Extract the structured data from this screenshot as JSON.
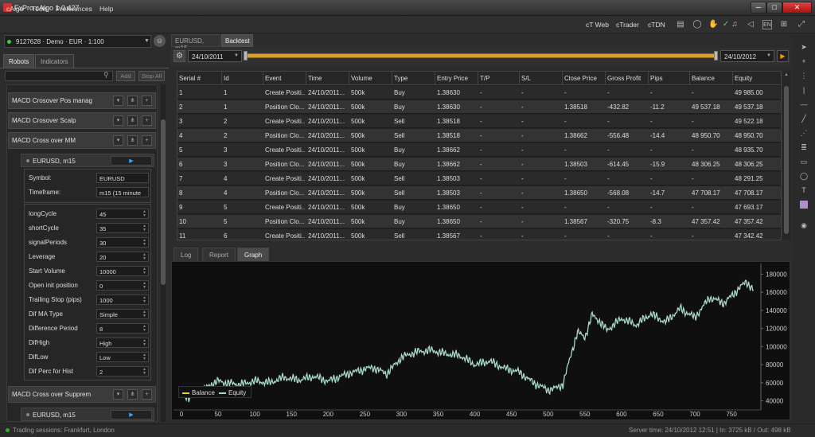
{
  "window": {
    "title": "FxPro cAlgo 1.0.427",
    "min": "─",
    "max": "□",
    "close": "✕"
  },
  "menu": [
    "cAlgo",
    "Tools",
    "Preferences",
    "Help"
  ],
  "toplinks": [
    "cT Web",
    "cTrader",
    "cTDN"
  ],
  "toolbar_icons": [
    "document-icon",
    "chat-icon",
    "hand-icon",
    "check-icon",
    "speaker-icon",
    "keyboard-icon",
    "zoom-icon"
  ],
  "account": {
    "label": "9127628 · Demo · EUR · 1:100"
  },
  "left_tabs": [
    "Robots",
    "Indicators"
  ],
  "left_search": {
    "add": "Add",
    "stop_all": "Stop All"
  },
  "robots": [
    {
      "name": "MACD Crosover Pos  manag"
    },
    {
      "name": "MACD Crosover Scalp"
    },
    {
      "name": "MACD Cross over MM"
    }
  ],
  "instance": {
    "name": "EURUSD, m15"
  },
  "settings": [
    {
      "label": "Symbol:",
      "value": "EURUSD"
    },
    {
      "label": "Timeframe:",
      "value": "m15 (15 minute"
    }
  ],
  "params": [
    {
      "label": "longCycle",
      "value": "45"
    },
    {
      "label": "shortCycle",
      "value": "35"
    },
    {
      "label": "signalPeriods",
      "value": "30"
    },
    {
      "label": "Leverage",
      "value": "20"
    },
    {
      "label": "Start Volume",
      "value": "10000"
    },
    {
      "label": "Open init position",
      "value": "0"
    },
    {
      "label": "Trailing Stop (pips)",
      "value": "1000"
    },
    {
      "label": "Dif MA Type",
      "value": "Simple"
    },
    {
      "label": "Difference Period",
      "value": "8"
    },
    {
      "label": "DifHigh",
      "value": "High"
    },
    {
      "label": "DifLow",
      "value": "Low"
    },
    {
      "label": "Dif Perc for Hist",
      "value": "2"
    }
  ],
  "robot2": {
    "name": "MACD Cross over Supprem"
  },
  "instance2": {
    "name": "EURUSD, m15"
  },
  "doc_tabs": {
    "chart": "EURUSD, m15",
    "backtest": "Backtest"
  },
  "dates": {
    "start": "24/10/2011",
    "end": "24/10/2012"
  },
  "table": {
    "columns": [
      "Serial #",
      "Id",
      "Event",
      "Time",
      "Volume",
      "Type",
      "Entry Price",
      "T/P",
      "S/L",
      "Close Price",
      "Gross Profit",
      "Pips",
      "Balance",
      "Equity"
    ],
    "rows": [
      [
        "1",
        "1",
        "Create Positi...",
        "24/10/2011...",
        "500k",
        "Buy",
        "1.38630",
        "-",
        "-",
        "-",
        "-",
        "-",
        "-",
        "49 985.00"
      ],
      [
        "2",
        "1",
        "Position Clo...",
        "24/10/2011...",
        "500k",
        "Buy",
        "1.38630",
        "-",
        "-",
        "1.38518",
        "-432.82",
        "-11.2",
        "49 537.18",
        "49 537.18"
      ],
      [
        "3",
        "2",
        "Create Positi...",
        "24/10/2011...",
        "500k",
        "Sell",
        "1.38518",
        "-",
        "-",
        "-",
        "-",
        "-",
        "-",
        "49 522.18"
      ],
      [
        "4",
        "2",
        "Position Clo...",
        "24/10/2011...",
        "500k",
        "Sell",
        "1.38518",
        "-",
        "-",
        "1.38662",
        "-556.48",
        "-14.4",
        "48 950.70",
        "48 950.70"
      ],
      [
        "5",
        "3",
        "Create Positi...",
        "24/10/2011...",
        "500k",
        "Buy",
        "1.38662",
        "-",
        "-",
        "-",
        "-",
        "-",
        "-",
        "48 935.70"
      ],
      [
        "6",
        "3",
        "Position Clo...",
        "24/10/2011...",
        "500k",
        "Buy",
        "1.38662",
        "-",
        "-",
        "1.38503",
        "-614.45",
        "-15.9",
        "48 306.25",
        "48 306.25"
      ],
      [
        "7",
        "4",
        "Create Positi...",
        "24/10/2011...",
        "500k",
        "Sell",
        "1.38503",
        "-",
        "-",
        "-",
        "-",
        "-",
        "-",
        "48 291.25"
      ],
      [
        "8",
        "4",
        "Position Clo...",
        "24/10/2011...",
        "500k",
        "Sell",
        "1.38503",
        "-",
        "-",
        "1.38650",
        "-568.08",
        "-14.7",
        "47 708.17",
        "47 708.17"
      ],
      [
        "9",
        "5",
        "Create Positi...",
        "24/10/2011...",
        "500k",
        "Buy",
        "1.38650",
        "-",
        "-",
        "-",
        "-",
        "-",
        "-",
        "47 693.17"
      ],
      [
        "10",
        "5",
        "Position Clo...",
        "24/10/2011...",
        "500k",
        "Buy",
        "1.38650",
        "-",
        "-",
        "1.38567",
        "-320.75",
        "-8.3",
        "47 357.42",
        "47 357.42"
      ],
      [
        "11",
        "6",
        "Create Positi...",
        "24/10/2011...",
        "500k",
        "Sell",
        "1.38567",
        "-",
        "-",
        "-",
        "-",
        "-",
        "-",
        "47 342.42"
      ]
    ]
  },
  "bottom_tabs": [
    "Log",
    "Report",
    "Graph"
  ],
  "legend": {
    "balance": "Balance",
    "equity": "Equity",
    "balance_color": "#e6d21e",
    "equity_color": "#a8d8c8"
  },
  "chart_data": {
    "type": "line",
    "x_ticks": [
      0,
      50,
      100,
      150,
      200,
      250,
      300,
      350,
      400,
      450,
      500,
      550,
      600,
      650,
      700,
      750
    ],
    "y_ticks": [
      40000,
      60000,
      80000,
      100000,
      120000,
      140000,
      160000,
      180000
    ],
    "xlim": [
      0,
      790
    ],
    "ylim": [
      30000,
      190000
    ],
    "grid": false,
    "series": [
      {
        "name": "Equity",
        "x": [
          0,
          10,
          20,
          30,
          40,
          50,
          60,
          80,
          100,
          120,
          140,
          160,
          180,
          200,
          220,
          240,
          260,
          280,
          300,
          320,
          340,
          360,
          380,
          400,
          420,
          440,
          460,
          480,
          500,
          510,
          520,
          530,
          540,
          550,
          560,
          570,
          580,
          600,
          620,
          640,
          660,
          680,
          700,
          720,
          740,
          760,
          770,
          780
        ],
        "y": [
          48000,
          44000,
          48000,
          52000,
          58000,
          62000,
          60000,
          58000,
          62000,
          60000,
          66000,
          63000,
          67000,
          62000,
          68000,
          73000,
          77000,
          70000,
          88000,
          94000,
          96000,
          92000,
          90000,
          80000,
          84000,
          76000,
          72000,
          60000,
          52000,
          54000,
          58000,
          88000,
          116000,
          110000,
          135000,
          128000,
          118000,
          131000,
          124000,
          136000,
          127000,
          142000,
          132000,
          154000,
          148000,
          164000,
          172000,
          162000
        ]
      },
      {
        "name": "Balance",
        "x": [],
        "y": []
      }
    ]
  },
  "status": {
    "left": "Trading sessions:  Frankfurt, London",
    "right": "Server time: 24/10/2012 12:51  |  In: 3725 kB / Out: 498 kB"
  }
}
